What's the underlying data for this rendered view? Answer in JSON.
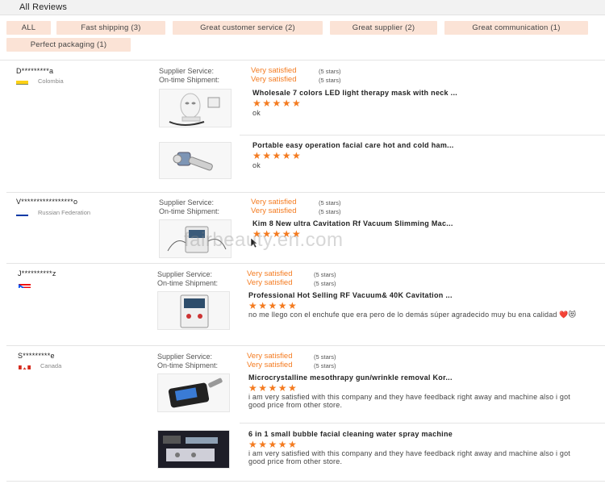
{
  "header": {
    "title": "All Reviews"
  },
  "filters": [
    {
      "label": "ALL"
    },
    {
      "label": "Fast shipping (3)"
    },
    {
      "label": "Great customer service (2)"
    },
    {
      "label": "Great supplier (2)"
    },
    {
      "label": "Great communication (1)"
    },
    {
      "label": "Perfect packaging (1)"
    }
  ],
  "meta_labels": {
    "supplier": "Supplier Service:",
    "shipment": "On-time Shipment:"
  },
  "reviews": [
    {
      "name": "D*********a",
      "country": "Colombia",
      "supplier_value": "Very satisfied",
      "supplier_stars": "(5 stars)",
      "shipment_value": "Very satisfied",
      "shipment_stars": "(5 stars)",
      "items": [
        {
          "title": "Wholesale 7 colors LED light therapy mask with neck ...",
          "stars": "★★★★★",
          "comment": "ok"
        },
        {
          "title": "Portable easy operation facial care hot and cold ham...",
          "stars": "★★★★★",
          "comment": "ok"
        }
      ]
    },
    {
      "name": "V*****************o",
      "country": "Russian Federation",
      "supplier_value": "Very satisfied",
      "supplier_stars": "(5 stars)",
      "shipment_value": "Very satisfied",
      "shipment_stars": "(5 stars)",
      "items": [
        {
          "title": "Kim 8 New ultra Cavitation Rf Vacuum Slimming Mac...",
          "stars": "★★★★★",
          "comment": ""
        }
      ]
    },
    {
      "name": "J**********z",
      "country": "",
      "supplier_value": "Very satisfied",
      "supplier_stars": "(5 stars)",
      "shipment_value": "Very satisfied",
      "shipment_stars": "(5 stars)",
      "items": [
        {
          "title": "Professional Hot Selling RF Vacuum& 40K Cavitation ...",
          "stars": "★★★★★",
          "comment": "no me llego con el enchufe que era pero de lo demás súper agradecido muy bu ena calidad ❤️😻"
        }
      ]
    },
    {
      "name": "S*********e",
      "country": "Canada",
      "supplier_value": "Very satisfied",
      "supplier_stars": "(5 stars)",
      "shipment_value": "Very satisfied",
      "shipment_stars": "(5 stars)",
      "items": [
        {
          "title": "Microcrystalline mesothrapy gun/wrinkle removal Kor...",
          "stars": "★★★★★",
          "comment": "i am very satisfied with this company and they have feedback right away and machine also i got good price from other store."
        },
        {
          "title": "6 in 1 small bubble facial cleaning water spray machine",
          "stars": "★★★★★",
          "comment": "i am very satisfied with this company and they have feedback right away and machine also i got good price from other store."
        }
      ]
    }
  ],
  "watermark": "fairbeauty.en.com",
  "colors": {
    "accent": "#f47b20",
    "tag_bg": "#fbe3d6",
    "header_bg": "#f2f2f2"
  }
}
